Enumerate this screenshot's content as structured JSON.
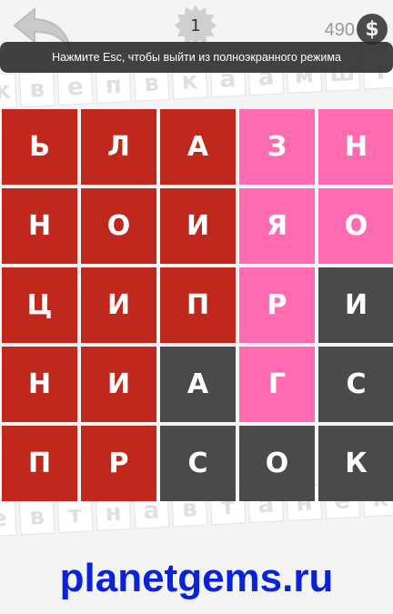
{
  "header": {
    "level": "1",
    "coins": "490",
    "coin_symbol": "$",
    "fullscreen_notice": "Нажмите Esc, чтобы выйти из полноэкранного режима"
  },
  "background_letters": {
    "top_row": [
      "ж",
      "в",
      "е",
      "п",
      "в",
      "к",
      "а",
      "а",
      "м",
      "ш",
      "т",
      "е"
    ],
    "bottom_row": [
      "е",
      "в",
      "т",
      "н",
      "а",
      "в",
      "т",
      "а",
      "н",
      "е",
      "к",
      "а"
    ]
  },
  "board": {
    "rows": [
      [
        {
          "letter": "Ь",
          "color": "red"
        },
        {
          "letter": "Л",
          "color": "red"
        },
        {
          "letter": "А",
          "color": "red"
        },
        {
          "letter": "З",
          "color": "pink"
        },
        {
          "letter": "Н",
          "color": "pink"
        }
      ],
      [
        {
          "letter": "Н",
          "color": "red"
        },
        {
          "letter": "О",
          "color": "red"
        },
        {
          "letter": "И",
          "color": "red"
        },
        {
          "letter": "Я",
          "color": "pink"
        },
        {
          "letter": "О",
          "color": "pink"
        }
      ],
      [
        {
          "letter": "Ц",
          "color": "red"
        },
        {
          "letter": "И",
          "color": "red"
        },
        {
          "letter": "П",
          "color": "red"
        },
        {
          "letter": "Р",
          "color": "pink"
        },
        {
          "letter": "И",
          "color": "dark"
        }
      ],
      [
        {
          "letter": "Н",
          "color": "red"
        },
        {
          "letter": "И",
          "color": "red"
        },
        {
          "letter": "А",
          "color": "dark"
        },
        {
          "letter": "Г",
          "color": "pink"
        },
        {
          "letter": "С",
          "color": "dark"
        }
      ],
      [
        {
          "letter": "П",
          "color": "red"
        },
        {
          "letter": "Р",
          "color": "red"
        },
        {
          "letter": "С",
          "color": "dark"
        },
        {
          "letter": "О",
          "color": "dark"
        },
        {
          "letter": "К",
          "color": "dark"
        }
      ]
    ]
  },
  "colors": {
    "red": "#c0281e",
    "pink": "#ff6bb0",
    "dark": "#4a4a4a"
  },
  "watermark": "planetgems.ru",
  "icons": {
    "back": "back-arrow-icon",
    "level": "star-badge-icon",
    "coin": "dollar-coin-icon"
  }
}
